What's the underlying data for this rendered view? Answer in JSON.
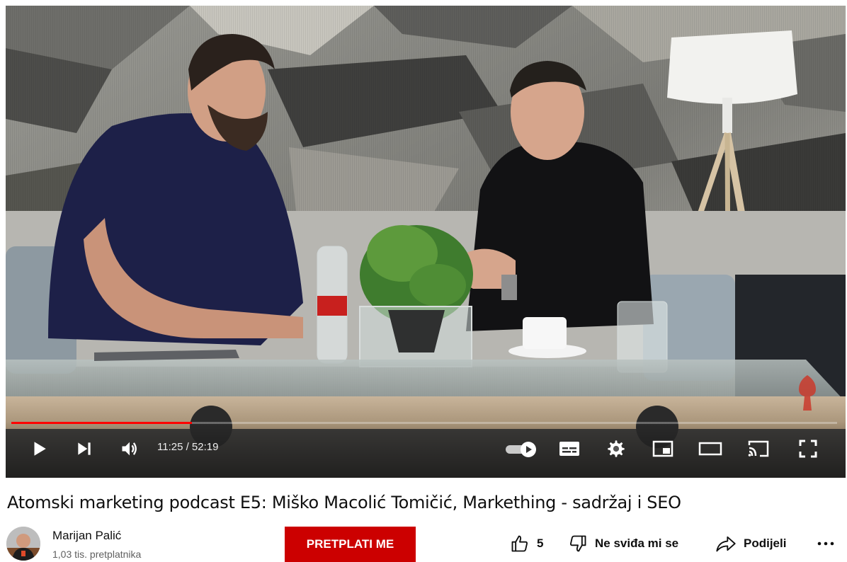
{
  "player": {
    "current_time": "11:25",
    "duration": "52:19",
    "time_display": "11:25 / 52:19",
    "progress_fraction": 0.2184,
    "autoplay": "on",
    "accent_color": "#ff0000"
  },
  "video": {
    "title": "Atomski marketing podcast E5: Miško Macolić Tomičić, Markething - sadržaj i SEO"
  },
  "channel": {
    "name": "Marijan Palić",
    "subscribers": "1,03 tis. pretplatnika",
    "subscribe_label": "PRETPLATI ME",
    "subscribe_color": "#cc0000"
  },
  "actions": {
    "like_count": "5",
    "dislike_label": "Ne sviđa mi se",
    "share_label": "Podijeli",
    "more_icon": "more-horizontal-icon"
  },
  "icons": [
    "play-icon",
    "next-icon",
    "volume-icon",
    "autoplay-toggle-icon",
    "subtitles-icon",
    "settings-gear-icon",
    "miniplayer-icon",
    "theater-mode-icon",
    "cast-icon",
    "fullscreen-icon",
    "like-icon",
    "dislike-icon",
    "share-icon"
  ]
}
